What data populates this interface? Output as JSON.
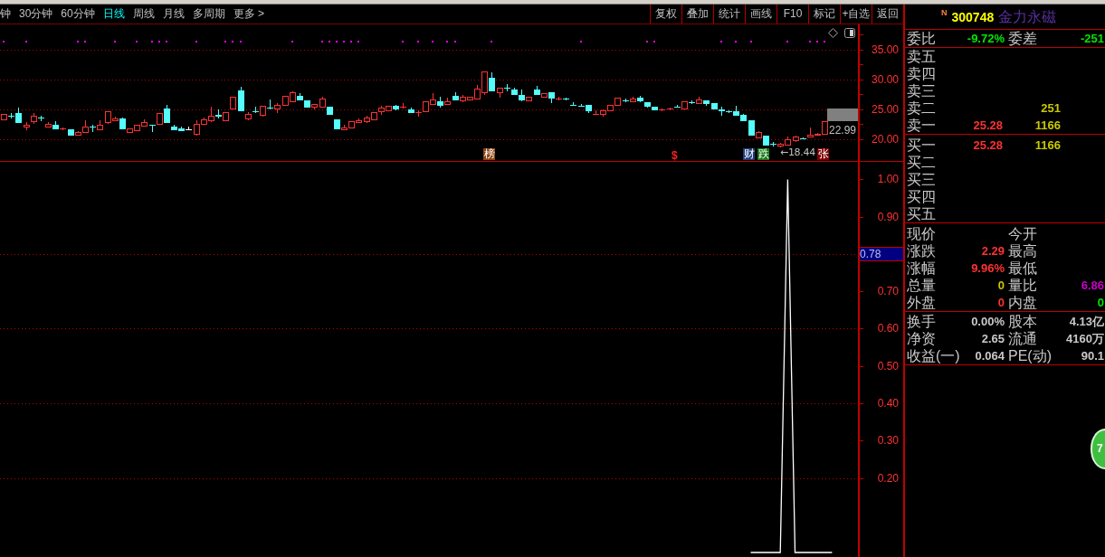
{
  "toolbar": {
    "periods": [
      {
        "label": "钟",
        "selected": false
      },
      {
        "label": "30分钟",
        "selected": false
      },
      {
        "label": "60分钟",
        "selected": false
      },
      {
        "label": "日线",
        "selected": true
      },
      {
        "label": "周线",
        "selected": false
      },
      {
        "label": "月线",
        "selected": false
      },
      {
        "label": "多周期",
        "selected": false
      },
      {
        "label": "更多 >",
        "selected": false
      }
    ],
    "actions": [
      "复权",
      "叠加",
      "统计",
      "画线",
      "F10",
      "标记",
      "+自选",
      "返回"
    ]
  },
  "price_chart": {
    "chart_data": {
      "type": "candlestick",
      "grid": true,
      "ylim": [
        16.33,
        39.21
      ],
      "yticks": [
        {
          "value": 35,
          "label": "35.00"
        },
        {
          "value": 30,
          "label": "30.00"
        },
        {
          "value": 25,
          "label": "25.00"
        },
        {
          "value": 20,
          "label": "20.00"
        }
      ],
      "categories": [
        null,
        null,
        null,
        null,
        null,
        null,
        null,
        null,
        null,
        null,
        null,
        null,
        null,
        null,
        null,
        null,
        null,
        null,
        null,
        null,
        null,
        null,
        null,
        null,
        null,
        null,
        null,
        null,
        null,
        null,
        null,
        null,
        null,
        null,
        null,
        null,
        null,
        null,
        null,
        null,
        null,
        null,
        null,
        null,
        null,
        null,
        null,
        null,
        null,
        null,
        null,
        null,
        null,
        null,
        null,
        null,
        null,
        null,
        null,
        null,
        null,
        null,
        null,
        null,
        null,
        null,
        null,
        null,
        null,
        null,
        null,
        null,
        null,
        null,
        null,
        null,
        null,
        null,
        null,
        null,
        null,
        null,
        null,
        null,
        null,
        null,
        null,
        null,
        null,
        null,
        null,
        null,
        null,
        null,
        null,
        null,
        null,
        null,
        null,
        null,
        null,
        null,
        null,
        null,
        null,
        null,
        null,
        null,
        null,
        null,
        null,
        null,
        null,
        null,
        null,
        null
      ],
      "ohlc": [
        [
          23.34,
          24.15,
          23.09,
          24.15
        ],
        [
          23.89,
          24.3,
          23.44,
          23.88
        ],
        [
          24.35,
          25.26,
          22.83,
          22.83
        ],
        [
          22.13,
          22.78,
          21.47,
          22.43
        ],
        [
          23.03,
          24.35,
          22.53,
          23.89
        ],
        [
          23.54,
          23.89,
          23.03,
          23.53
        ],
        [
          22.13,
          22.83,
          22.13,
          22.53
        ],
        [
          22.38,
          22.98,
          21.82,
          21.82
        ],
        [
          21.72,
          21.97,
          21.47,
          21.73
        ],
        [
          21.62,
          21.62,
          20.61,
          20.71
        ],
        [
          20.76,
          21.32,
          20.61,
          21.17
        ],
        [
          21.22,
          23.14,
          21.22,
          22.03
        ],
        [
          22.03,
          22.38,
          21.22,
          22.02
        ],
        [
          21.67,
          23.14,
          21.67,
          22.33
        ],
        [
          22.78,
          24.65,
          22.48,
          24.65
        ],
        [
          23.19,
          23.69,
          23.19,
          23.44
        ],
        [
          23.44,
          23.59,
          21.62,
          21.82
        ],
        [
          21.22,
          21.77,
          21.22,
          21.77
        ],
        [
          21.52,
          22.38,
          21.52,
          22.38
        ],
        [
          22.28,
          23.29,
          22.28,
          22.83
        ],
        [
          22.33,
          22.33,
          21.22,
          22.32
        ],
        [
          22.58,
          24.3,
          22.43,
          24.3
        ],
        [
          25.11,
          25.71,
          22.83,
          22.83
        ],
        [
          22.08,
          22.38,
          21.67,
          21.67
        ],
        [
          21.77,
          22.03,
          21.52,
          21.52
        ],
        [
          21.62,
          22.13,
          21.47,
          21.62
        ],
        [
          20.91,
          23.14,
          20.61,
          22.53
        ],
        [
          22.58,
          23.64,
          22.58,
          23.29
        ],
        [
          23.19,
          25.41,
          22.88,
          23.89
        ],
        [
          23.99,
          24.95,
          23.49,
          23.98
        ],
        [
          23.19,
          24.45,
          23.19,
          24.45
        ],
        [
          25.16,
          27.08,
          25.16,
          27.08
        ],
        [
          28.14,
          28.74,
          24.85,
          24.85
        ],
        [
          23.39,
          24.45,
          23.19,
          24.2
        ],
        [
          24.65,
          25.41,
          24.35,
          24.64
        ],
        [
          24.1,
          25.51,
          23.79,
          25.51
        ],
        [
          25.31,
          26.62,
          25.01,
          25.3
        ],
        [
          25.11,
          26.02,
          24.35,
          25.71
        ],
        [
          25.66,
          27.23,
          25.66,
          27.23
        ],
        [
          26.37,
          28.04,
          26.37,
          27.83
        ],
        [
          27.23,
          27.68,
          26.47,
          26.67
        ],
        [
          26.47,
          26.47,
          25.46,
          25.46
        ],
        [
          25.46,
          25.81,
          24.95,
          25.81
        ],
        [
          25.46,
          27.08,
          25.21,
          26.77
        ],
        [
          25.41,
          25.41,
          24.25,
          24.25
        ],
        [
          23.29,
          23.29,
          21.82,
          21.82
        ],
        [
          21.57,
          22.38,
          21.57,
          21.92
        ],
        [
          21.97,
          22.93,
          21.97,
          22.93
        ],
        [
          22.88,
          23.49,
          22.88,
          23.14
        ],
        [
          22.93,
          23.89,
          22.73,
          23.59
        ],
        [
          23.34,
          24.45,
          23.34,
          24.45
        ],
        [
          24.6,
          25.51,
          24.1,
          25.26
        ],
        [
          24.75,
          25.51,
          24.75,
          25.51
        ],
        [
          25.61,
          25.76,
          24.85,
          25.11
        ],
        [
          25.41,
          26.02,
          25.11,
          25.42
        ],
        [
          24.95,
          25.26,
          24.4,
          24.55
        ],
        [
          24.55,
          24.75,
          23.79,
          24.56
        ],
        [
          24.7,
          26.32,
          24.7,
          26.32
        ],
        [
          25.91,
          27.68,
          25.66,
          26.62
        ],
        [
          26.32,
          27.08,
          25.31,
          25.76
        ],
        [
          25.91,
          26.92,
          25.91,
          26.32
        ],
        [
          27.18,
          27.83,
          26.52,
          26.67
        ],
        [
          26.42,
          27.43,
          26.12,
          27.08
        ],
        [
          26.57,
          27.08,
          26.57,
          27.08
        ],
        [
          26.82,
          29.05,
          26.82,
          28.44
        ],
        [
          27.83,
          31.32,
          27.43,
          31.32
        ],
        [
          30.26,
          31.22,
          28.19,
          28.19
        ],
        [
          27.78,
          28.54,
          26.92,
          28.54
        ],
        [
          28.54,
          29.2,
          27.93,
          28.53
        ],
        [
          28.34,
          28.54,
          27.38,
          27.58
        ],
        [
          27.43,
          28.29,
          26.27,
          26.67
        ],
        [
          26.42,
          27.08,
          26.27,
          27.08
        ],
        [
          28.34,
          28.94,
          27.43,
          27.58
        ],
        [
          27.13,
          27.63,
          27.13,
          27.63
        ],
        [
          27.83,
          27.83,
          26.07,
          26.92
        ],
        [
          26.82,
          27.08,
          26.52,
          26.83
        ],
        [
          26.77,
          26.92,
          26.42,
          26.76
        ],
        [
          25.71,
          26.12,
          25.51,
          25.7
        ],
        [
          25.61,
          25.91,
          25.41,
          25.6
        ],
        [
          25.66,
          25.66,
          24.4,
          24.85
        ],
        [
          24.2,
          24.75,
          24.1,
          24.21
        ],
        [
          24.25,
          24.95,
          23.74,
          24.75
        ],
        [
          24.75,
          25.66,
          24.75,
          25.66
        ],
        [
          25.71,
          26.92,
          25.71,
          26.92
        ],
        [
          26.47,
          26.82,
          26.12,
          26.46
        ],
        [
          26.32,
          27.08,
          26.17,
          26.82
        ],
        [
          26.92,
          27.23,
          26.17,
          26.42
        ],
        [
          26.17,
          26.17,
          25.31,
          25.61
        ],
        [
          25.41,
          25.41,
          25.01,
          25.01
        ],
        [
          25.01,
          25.11,
          24.7,
          25.02
        ],
        [
          25.06,
          25.21,
          24.8,
          25.07
        ],
        [
          25.41,
          25.66,
          25.26,
          25.4
        ],
        [
          25.06,
          26.27,
          25.06,
          26.27
        ],
        [
          26.17,
          26.42,
          25.91,
          26.16
        ],
        [
          25.96,
          27.08,
          25.96,
          26.67
        ],
        [
          26.47,
          26.47,
          25.51,
          26.02
        ],
        [
          26.07,
          26.07,
          25.06,
          25.06
        ],
        [
          24.9,
          25.41,
          23.94,
          24.89
        ],
        [
          24.6,
          24.75,
          24.4,
          24.59
        ],
        [
          24.7,
          25.56,
          24.1,
          24.1
        ],
        [
          24.04,
          24.2,
          22.93,
          23.19
        ],
        [
          23.19,
          23.19,
          20.76,
          20.76
        ],
        [
          20.21,
          21.37,
          20.21,
          21.17
        ],
        [
          20.56,
          20.56,
          19.1,
          19.1
        ],
        [
          19.25,
          19.5,
          18.69,
          19.24
        ],
        [
          18.89,
          19.35,
          18.64,
          19.15
        ],
        [
          19.05,
          20.36,
          18.84,
          19.95
        ],
        [
          19.75,
          20.56,
          19.55,
          20.36
        ],
        [
          20.11,
          20.31,
          19.95,
          20.1
        ],
        [
          20.36,
          21.87,
          20.36,
          20.66
        ],
        [
          20.66,
          21.02,
          20.66,
          20.86
        ],
        [
          20.81,
          22.98,
          20.81,
          22.98
        ],
        null,
        null,
        null,
        null
      ]
    },
    "last_price": "22.99",
    "low_label": "←18.44",
    "tags": [
      {
        "kind": "tag",
        "text": "榜",
        "color": "#8b4513"
      },
      {
        "kind": "symbol",
        "text": "$",
        "color": "#ff2020"
      },
      {
        "kind": "tag",
        "text": "财",
        "color": "#1f3c78"
      },
      {
        "kind": "tag",
        "text": "跌",
        "color": "#1a7a1a"
      },
      {
        "kind": "tag",
        "text": "张",
        "color": "#7f0000"
      }
    ]
  },
  "indicator_chart": {
    "cursor_value": "0.78",
    "chart_data": {
      "type": "line",
      "grid": true,
      "ylim": [
        -0.012,
        1.047
      ],
      "yticks": [
        {
          "value": 1,
          "label": "1.00"
        },
        {
          "value": 0.9,
          "label": "0.90"
        },
        {
          "value": 0.7,
          "label": "0.70"
        },
        {
          "value": 0.6,
          "label": "0.60"
        },
        {
          "value": 0.5,
          "label": "0.50"
        },
        {
          "value": 0.4,
          "label": "0.40"
        },
        {
          "value": 0.3,
          "label": "0.30"
        },
        {
          "value": 0.2,
          "label": "0.20"
        }
      ],
      "categories": [
        null,
        null,
        null,
        null,
        null,
        null,
        null,
        null,
        null,
        null,
        null,
        null,
        null,
        null,
        null,
        null,
        null,
        null,
        null,
        null,
        null,
        null,
        null,
        null,
        null,
        null,
        null,
        null,
        null,
        null,
        null,
        null,
        null,
        null,
        null,
        null,
        null,
        null,
        null,
        null,
        null,
        null,
        null,
        null,
        null,
        null,
        null,
        null,
        null,
        null,
        null,
        null,
        null,
        null,
        null,
        null,
        null,
        null,
        null,
        null,
        null,
        null,
        null,
        null,
        null,
        null,
        null,
        null,
        null,
        null,
        null,
        null,
        null,
        null,
        null,
        null,
        null,
        null,
        null,
        null,
        null,
        null,
        null,
        null,
        null,
        null,
        null,
        null,
        null,
        null,
        null,
        null,
        null,
        null,
        null,
        null,
        null,
        null,
        null,
        null,
        null,
        null,
        null,
        null,
        null,
        null,
        null,
        null,
        null,
        null,
        null,
        null,
        null,
        null,
        null,
        null
      ],
      "series": [
        {
          "color": "#ffffff",
          "values": [
            null,
            null,
            null,
            null,
            null,
            null,
            null,
            null,
            null,
            null,
            null,
            null,
            null,
            null,
            null,
            null,
            null,
            null,
            null,
            null,
            null,
            null,
            null,
            null,
            null,
            null,
            null,
            null,
            null,
            null,
            null,
            null,
            null,
            null,
            null,
            null,
            null,
            null,
            null,
            null,
            null,
            null,
            null,
            null,
            null,
            null,
            null,
            null,
            null,
            null,
            null,
            null,
            null,
            null,
            null,
            null,
            null,
            null,
            null,
            null,
            null,
            null,
            null,
            null,
            null,
            null,
            null,
            null,
            null,
            null,
            null,
            null,
            null,
            null,
            null,
            null,
            null,
            null,
            null,
            null,
            null,
            null,
            null,
            null,
            null,
            null,
            null,
            null,
            null,
            null,
            null,
            null,
            null,
            null,
            null,
            null,
            null,
            null,
            null,
            null,
            null,
            0,
            0,
            0,
            0,
            0,
            1,
            0,
            0,
            0,
            0,
            0,
            0,
            null,
            null,
            null
          ]
        }
      ]
    }
  },
  "quote_panel": {
    "badge": "N",
    "code": "300748",
    "name": "金力永磁",
    "order_stats": [
      {
        "label": "委比",
        "value": "-9.72%",
        "color": "#00e600"
      },
      {
        "label": "委差",
        "value": "-251",
        "color": "#00e600"
      }
    ],
    "asks": [
      {
        "label": "卖五"
      },
      {
        "label": "卖四"
      },
      {
        "label": "卖三"
      },
      {
        "label": "卖二",
        "volume": "251"
      },
      {
        "label": "卖一",
        "price": "25.28",
        "volume": "1166"
      }
    ],
    "bids": [
      {
        "label": "买一",
        "price": "25.28",
        "volume": "1166"
      },
      {
        "label": "买二"
      },
      {
        "label": "买三"
      },
      {
        "label": "买四"
      },
      {
        "label": "买五"
      }
    ],
    "stats": [
      {
        "label": "现价"
      },
      {
        "label": "今开"
      },
      {
        "label": "涨跌",
        "value": "2.29",
        "color": "#ff3232"
      },
      {
        "label": "最高"
      },
      {
        "label": "涨幅",
        "value": "9.96%",
        "color": "#ff3232"
      },
      {
        "label": "最低"
      },
      {
        "label": "总量",
        "value": "0",
        "color": "#c8c800"
      },
      {
        "label": "量比",
        "value": "6.86",
        "color": "#c800c8"
      },
      {
        "label": "外盘",
        "value": "0",
        "color": "#ff3232"
      },
      {
        "label": "内盘",
        "value": "0",
        "color": "#00e600"
      }
    ],
    "fundamentals": [
      {
        "label": "换手",
        "value": "0.00%"
      },
      {
        "label": "股本",
        "value": "4.13亿"
      },
      {
        "label": "净资",
        "value": "2.65"
      },
      {
        "label": "流通",
        "value": "4160万"
      },
      {
        "label": "收益(一)",
        "value": "0.064"
      },
      {
        "label": "PE(动)",
        "value": "90.1"
      }
    ]
  },
  "floating_ball": {
    "label": "7"
  }
}
